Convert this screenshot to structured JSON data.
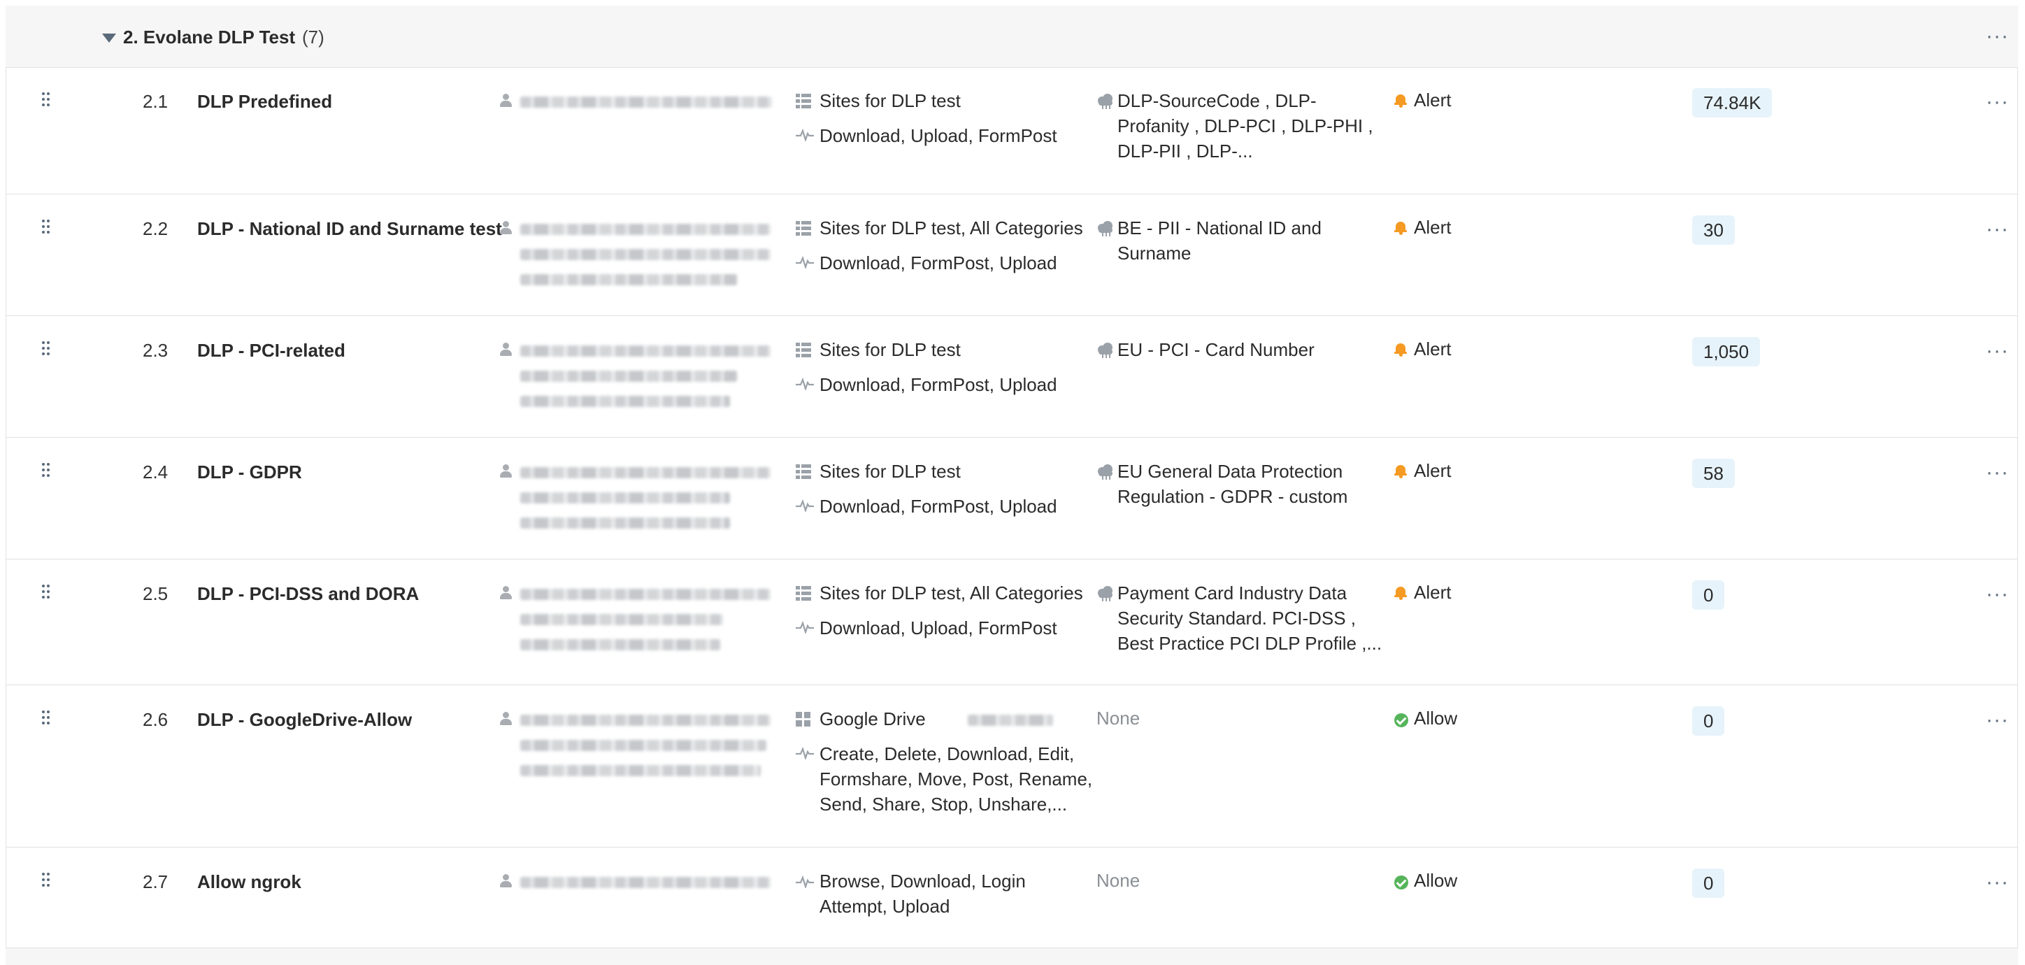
{
  "group": {
    "title": "2. Evolane DLP Test",
    "count": "(7)",
    "menu": "···"
  },
  "rows": [
    {
      "num": "2.1",
      "name": "DLP Predefined",
      "destinations": "Sites for DLP test",
      "destination_icon": "list-icon",
      "activities": "Download, Upload, FormPost",
      "profiles": [
        "DLP-SourceCode , DLP-",
        "Profanity , DLP-PCI , DLP-PHI ,",
        "DLP-PII , DLP-..."
      ],
      "action": "Alert",
      "action_icon": "bell-icon",
      "hits": "74.84K",
      "menu": "···"
    },
    {
      "num": "2.2",
      "name": "DLP - National ID and Surname test",
      "destinations": "Sites for DLP test, All Categories",
      "destination_icon": "list-icon",
      "activities": "Download, FormPost, Upload",
      "profiles": [
        "BE - PII - National ID and",
        "Surname"
      ],
      "action": "Alert",
      "action_icon": "bell-icon",
      "hits": "30",
      "menu": "···"
    },
    {
      "num": "2.3",
      "name": "DLP - PCI-related",
      "destinations": "Sites for DLP test",
      "destination_icon": "list-icon",
      "activities": "Download, FormPost, Upload",
      "profiles": [
        "EU - PCI - Card Number"
      ],
      "action": "Alert",
      "action_icon": "bell-icon",
      "hits": "1,050",
      "menu": "···"
    },
    {
      "num": "2.4",
      "name": "DLP - GDPR",
      "destinations": "Sites for DLP test",
      "destination_icon": "list-icon",
      "activities": "Download, FormPost, Upload",
      "profiles": [
        "EU General Data Protection",
        "Regulation - GDPR - custom"
      ],
      "action": "Alert",
      "action_icon": "bell-icon",
      "hits": "58",
      "menu": "···"
    },
    {
      "num": "2.5",
      "name": "DLP - PCI-DSS and DORA",
      "destinations": "Sites for DLP test, All Categories",
      "destination_icon": "list-icon",
      "activities": "Download, Upload, FormPost",
      "profiles": [
        "Payment Card Industry Data",
        "Security Standard. PCI-DSS ,",
        "Best Practice PCI DLP Profile ,..."
      ],
      "action": "Alert",
      "action_icon": "bell-icon",
      "hits": "0",
      "menu": "···"
    },
    {
      "num": "2.6",
      "name": "DLP - GoogleDrive-Allow",
      "destinations": "Google Drive",
      "destination_icon": "app-grid-icon",
      "activities": [
        "Create, Delete, Download, Edit,",
        "Formshare, Move, Post, Rename,",
        "Send, Share, Stop, Unshare,..."
      ],
      "profiles_none": "None",
      "action": "Allow",
      "action_icon": "check-circle-icon",
      "hits": "0",
      "menu": "···"
    },
    {
      "num": "2.7",
      "name": "Allow ngrok",
      "activities": [
        "Browse, Download, Login",
        "Attempt, Upload"
      ],
      "profiles_none": "None",
      "action": "Allow",
      "action_icon": "check-circle-icon",
      "hits": "0",
      "menu": "···"
    }
  ],
  "colors": {
    "alert": "#f59a23",
    "allow": "#56b45a",
    "badge_bg": "#e7f3fb",
    "header_bg": "#f6f6f6"
  }
}
